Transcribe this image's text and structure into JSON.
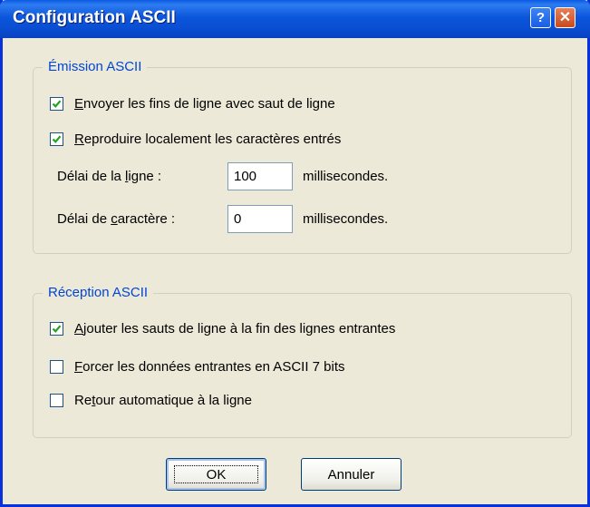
{
  "window": {
    "title": "Configuration ASCII"
  },
  "title_buttons": {
    "help": "?",
    "close": "✕"
  },
  "emission": {
    "legend": "Émission ASCII",
    "send_line_ends": {
      "pre": "",
      "ul": "E",
      "post": "nvoyer les fins de ligne avec saut de ligne",
      "checked": true
    },
    "local_echo": {
      "pre": "",
      "ul": "R",
      "post": "eproduire localement les caractères entrés",
      "checked": true
    },
    "line_delay": {
      "pre": "Délai de la ",
      "ul": "l",
      "post": "igne :",
      "value": "100",
      "unit": "millisecondes."
    },
    "char_delay": {
      "pre": "Délai de ",
      "ul": "c",
      "post": "aractère :",
      "value": "0",
      "unit": "millisecondes."
    }
  },
  "reception": {
    "legend": "Réception ASCII",
    "append_line_feeds": {
      "pre": "",
      "ul": "A",
      "post": "jouter les sauts de ligne à la fin des lignes entrantes",
      "checked": true
    },
    "force_7bit": {
      "pre": "",
      "ul": "F",
      "post": "orcer les données entrantes en ASCII 7 bits",
      "checked": false
    },
    "wrap_lines": {
      "pre": "Re",
      "ul": "t",
      "post": "our automatique à la ligne",
      "checked": false
    }
  },
  "buttons": {
    "ok": "OK",
    "cancel": "Annuler"
  },
  "colors": {
    "titlebar": "#0a4fd4",
    "group_legend": "#0046d5",
    "dialog_bg": "#ece9d8",
    "check": "#21a121"
  }
}
